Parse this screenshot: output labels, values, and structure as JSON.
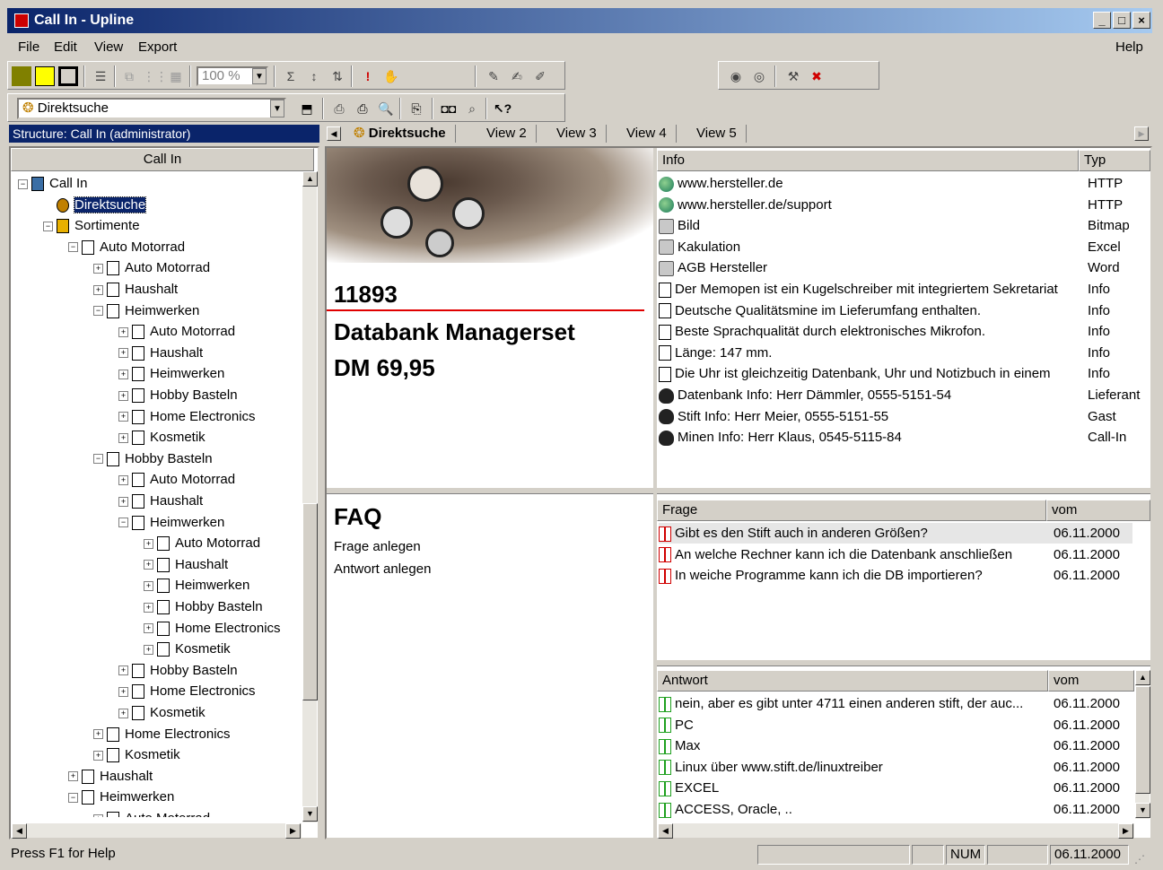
{
  "window": {
    "title": "Call In - Upline",
    "min": "_",
    "max": "□",
    "close": "×"
  },
  "menu": {
    "file": "File",
    "edit": "Edit",
    "view": "View",
    "export": "Export",
    "help": "Help"
  },
  "toolbar": {
    "zoom": "100 %",
    "view_selector": "Direktsuche"
  },
  "structure_header": "Structure: Call In (administrator)",
  "tree_header": "Call In",
  "tree": [
    {
      "label": "Call In",
      "d": 0,
      "exp": "−"
    },
    {
      "label": "Direktsuche",
      "d": 1,
      "exp": "",
      "sel": true
    },
    {
      "label": "Sortimente",
      "d": 1,
      "exp": "−"
    },
    {
      "label": "Auto Motorrad",
      "d": 2,
      "exp": "−"
    },
    {
      "label": "Auto Motorrad",
      "d": 3,
      "exp": "+"
    },
    {
      "label": "Haushalt",
      "d": 3,
      "exp": "+"
    },
    {
      "label": "Heimwerken",
      "d": 3,
      "exp": "−"
    },
    {
      "label": "Auto Motorrad",
      "d": 4,
      "exp": "+"
    },
    {
      "label": "Haushalt",
      "d": 4,
      "exp": "+"
    },
    {
      "label": "Heimwerken",
      "d": 4,
      "exp": "+"
    },
    {
      "label": "Hobby Basteln",
      "d": 4,
      "exp": "+"
    },
    {
      "label": "Home Electronics",
      "d": 4,
      "exp": "+"
    },
    {
      "label": "Kosmetik",
      "d": 4,
      "exp": "+"
    },
    {
      "label": "Hobby Basteln",
      "d": 3,
      "exp": "−"
    },
    {
      "label": "Auto Motorrad",
      "d": 4,
      "exp": "+"
    },
    {
      "label": "Haushalt",
      "d": 4,
      "exp": "+"
    },
    {
      "label": "Heimwerken",
      "d": 4,
      "exp": "−"
    },
    {
      "label": "Auto Motorrad",
      "d": 5,
      "exp": "+"
    },
    {
      "label": "Haushalt",
      "d": 5,
      "exp": "+"
    },
    {
      "label": "Heimwerken",
      "d": 5,
      "exp": "+"
    },
    {
      "label": "Hobby Basteln",
      "d": 5,
      "exp": "+"
    },
    {
      "label": "Home Electronics",
      "d": 5,
      "exp": "+"
    },
    {
      "label": "Kosmetik",
      "d": 5,
      "exp": "+"
    },
    {
      "label": "Hobby Basteln",
      "d": 4,
      "exp": "+"
    },
    {
      "label": "Home Electronics",
      "d": 4,
      "exp": "+"
    },
    {
      "label": "Kosmetik",
      "d": 4,
      "exp": "+"
    },
    {
      "label": "Home Electronics",
      "d": 3,
      "exp": "+"
    },
    {
      "label": "Kosmetik",
      "d": 3,
      "exp": "+"
    },
    {
      "label": "Haushalt",
      "d": 2,
      "exp": "+"
    },
    {
      "label": "Heimwerken",
      "d": 2,
      "exp": "−"
    },
    {
      "label": "Auto Motorrad",
      "d": 3,
      "exp": "+"
    }
  ],
  "tabs": [
    "Direktsuche",
    "View 2",
    "View 3",
    "View 4",
    "View 5"
  ],
  "product": {
    "number": "11893",
    "name": "Databank Managerset",
    "price": "DM 69,95"
  },
  "info_grid": {
    "headers": [
      "Info",
      "Typ"
    ],
    "rows": [
      {
        "info": "www.hersteller.de",
        "typ": "HTTP",
        "icon": "globe-icon"
      },
      {
        "info": "www.hersteller.de/support",
        "typ": "HTTP",
        "icon": "globe-icon"
      },
      {
        "info": "Bild",
        "typ": "Bitmap",
        "icon": "cube-icon"
      },
      {
        "info": "Kakulation",
        "typ": "Excel",
        "icon": "cube-icon"
      },
      {
        "info": "AGB Hersteller",
        "typ": "Word",
        "icon": "cube-icon"
      },
      {
        "info": "Der Memopen ist ein Kugelschreiber mit integriertem Sekretariat",
        "typ": "Info",
        "icon": "document-icon"
      },
      {
        "info": "Deutsche Qualitätsmine im Lieferumfang enthalten.",
        "typ": "Info",
        "icon": "document-icon"
      },
      {
        "info": "Beste Sprachqualität durch elektronisches Mikrofon.",
        "typ": "Info",
        "icon": "document-icon"
      },
      {
        "info": "Länge: 147 mm.",
        "typ": "Info",
        "icon": "document-icon"
      },
      {
        "info": "Die Uhr ist gleichzeitig Datenbank, Uhr und Notizbuch in einem",
        "typ": "Info",
        "icon": "document-icon"
      },
      {
        "info": "Datenbank Info: Herr Dämmler, 0555-5151-54",
        "typ": "Lieferant",
        "icon": "person-icon"
      },
      {
        "info": "Stift Info: Herr Meier, 0555-5151-55",
        "typ": "Gast",
        "icon": "person-icon"
      },
      {
        "info": "Minen Info: Herr Klaus, 0545-5115-84",
        "typ": "Call-In",
        "icon": "person-icon"
      }
    ]
  },
  "faq": {
    "title": "FAQ",
    "new_question": "Frage anlegen",
    "new_answer": "Antwort anlegen"
  },
  "question_grid": {
    "headers": [
      "Frage",
      "vom"
    ],
    "rows": [
      {
        "text": "Gibt es den Stift auch in anderen Größen?",
        "date": "06.11.2000"
      },
      {
        "text": "An welche Rechner kann ich die Datenbank anschließen",
        "date": "06.11.2000"
      },
      {
        "text": "In weiche Programme kann ich die DB importieren?",
        "date": "06.11.2000"
      }
    ]
  },
  "answer_grid": {
    "headers": [
      "Antwort",
      "vom"
    ],
    "rows": [
      {
        "text": "nein, aber es gibt unter 4711 einen anderen stift, der auc...",
        "date": "06.11.2000"
      },
      {
        "text": "PC",
        "date": "06.11.2000"
      },
      {
        "text": "Max",
        "date": "06.11.2000"
      },
      {
        "text": "Linux über www.stift.de/linuxtreiber",
        "date": "06.11.2000"
      },
      {
        "text": "EXCEL",
        "date": "06.11.2000"
      },
      {
        "text": "ACCESS, Oracle, ..",
        "date": "06.11.2000"
      }
    ]
  },
  "status": {
    "help": "Press F1 for Help",
    "num": "NUM",
    "date": "06.11.2000"
  },
  "colors": {
    "title_start": "#0a246a",
    "title_end": "#a6caf0",
    "accent_line": "#e00000",
    "question_icon": "#d00000",
    "answer_icon": "#20a020"
  }
}
